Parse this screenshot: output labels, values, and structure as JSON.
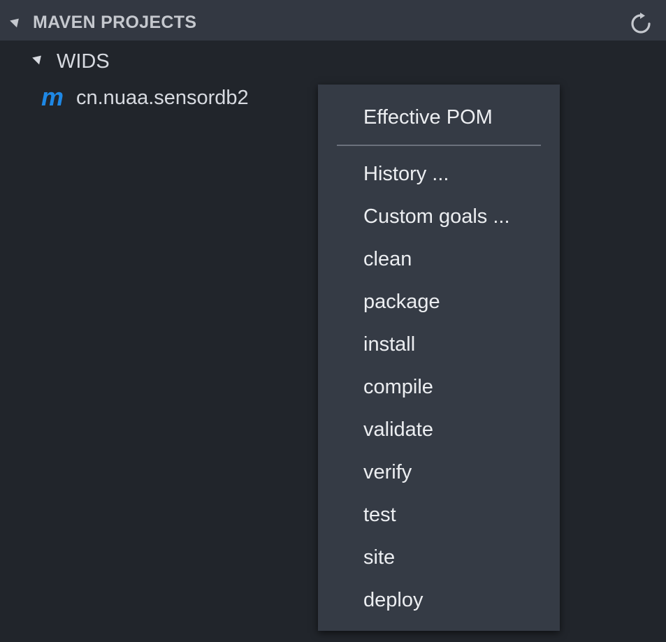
{
  "header": {
    "title": "MAVEN PROJECTS",
    "refresh_icon": "refresh-icon"
  },
  "tree": {
    "root_label": "WIDS",
    "child_label": "cn.nuaa.sensordb2",
    "child_icon": "maven-icon",
    "icon_color": "#1e88e5"
  },
  "context_menu": {
    "items": [
      "Effective POM",
      "History ...",
      "Custom goals ...",
      "clean",
      "package",
      "install",
      "compile",
      "validate",
      "verify",
      "test",
      "site",
      "deploy"
    ]
  },
  "colors": {
    "panel_bg": "#21252b",
    "header_bg": "#333842",
    "menu_bg": "#353b45",
    "text": "#d7dae0"
  }
}
